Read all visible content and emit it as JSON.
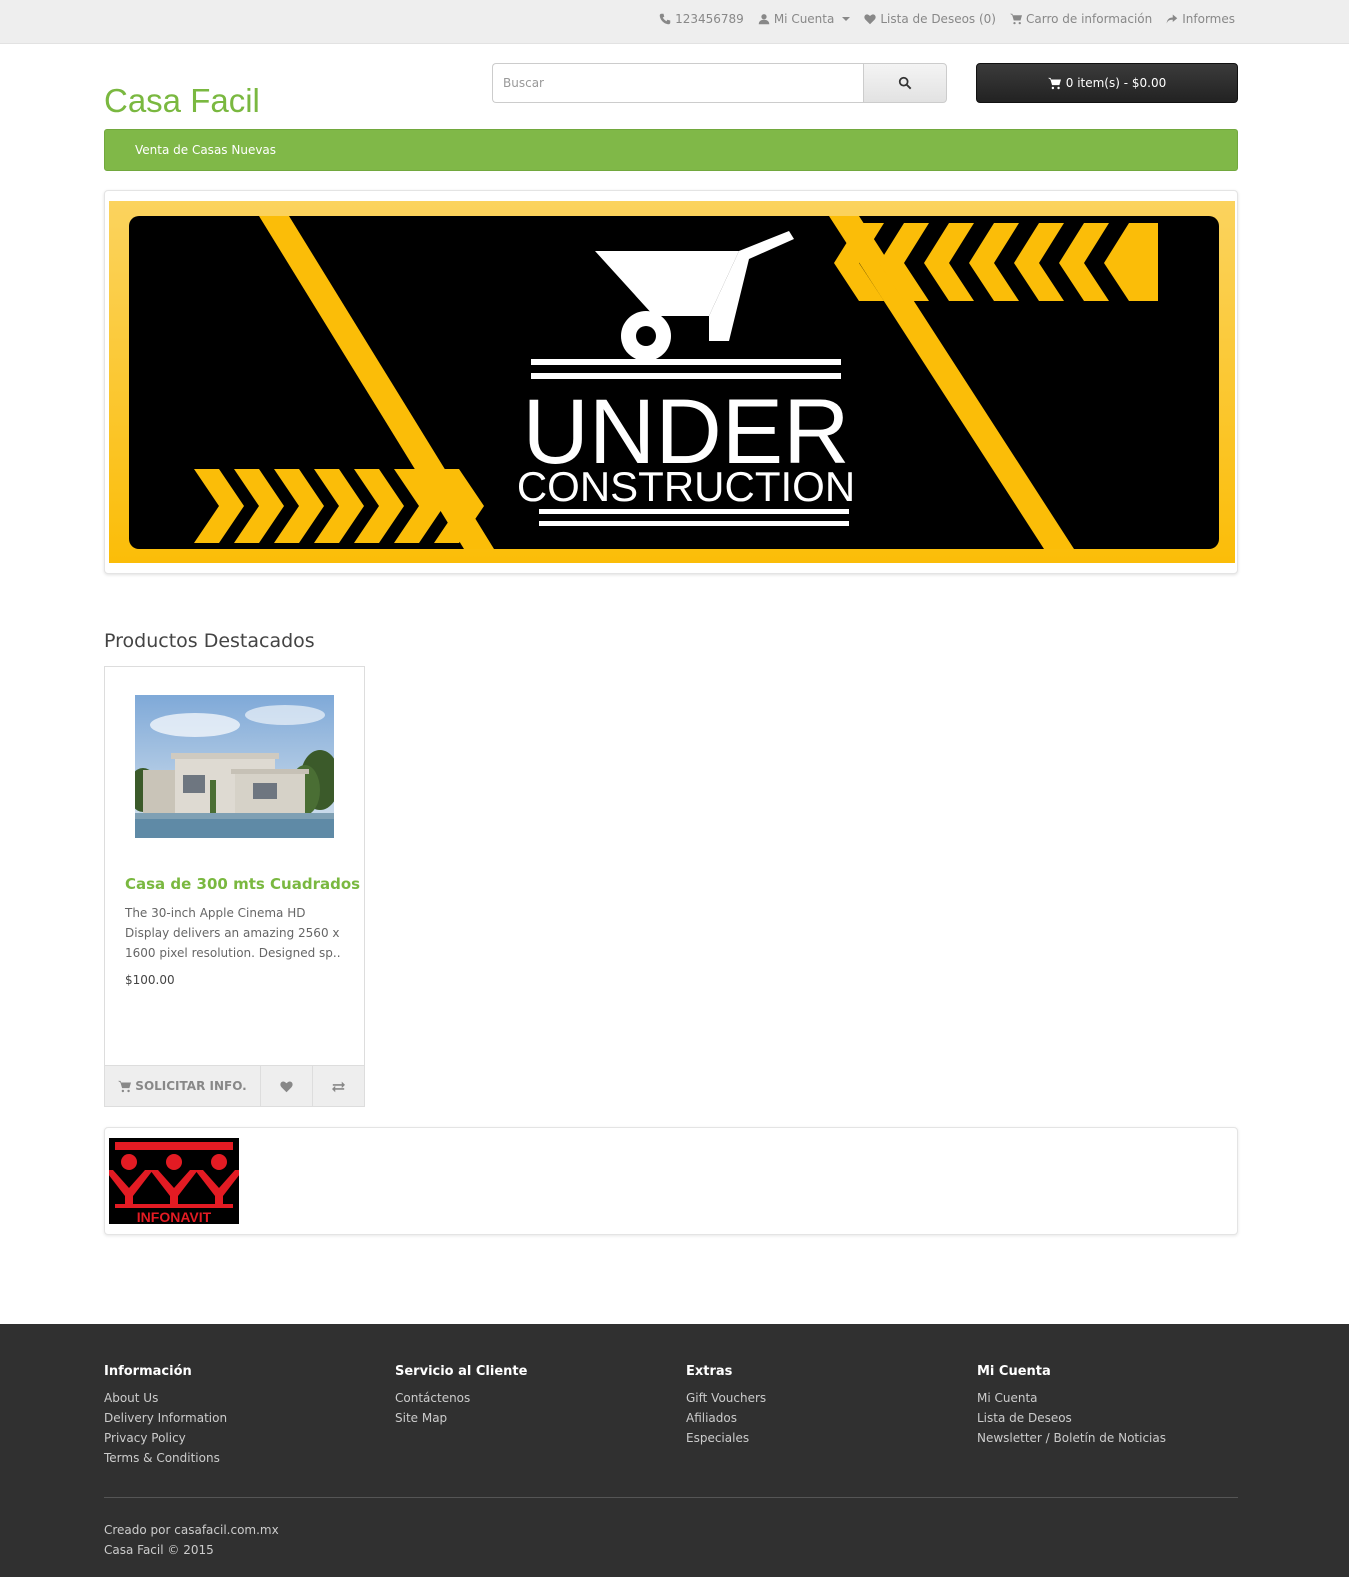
{
  "topbar": {
    "phone": "123456789",
    "account": "Mi Cuenta",
    "wishlist": "Lista de Deseos (0)",
    "cart": "Carro de información",
    "checkout": "Informes"
  },
  "header": {
    "logo": "Casa Facil",
    "search_placeholder": "Buscar",
    "cart_button": "0 item(s) - $0.00"
  },
  "nav": {
    "items": [
      "Venta de Casas Nuevas"
    ]
  },
  "banner": {
    "line1": "UNDER",
    "line2": "CONSTRUCTION"
  },
  "featured": {
    "title": "Productos Destacados",
    "products": [
      {
        "name": "Casa de 300 mts Cuadrados",
        "description": "The 30-inch Apple Cinema HD Display delivers an amazing 2560 x 1600 pixel resolution. Designed sp..",
        "price": "$100.00",
        "cart_label": "SOLICITAR INFO."
      }
    ]
  },
  "carousel": {
    "logo_text": "INFONAVIT"
  },
  "footer": {
    "columns": [
      {
        "title": "Información",
        "links": [
          "About Us",
          "Delivery Information",
          "Privacy Policy",
          "Terms & Conditions"
        ]
      },
      {
        "title": "Servicio al Cliente",
        "links": [
          "Contáctenos",
          "Site Map"
        ]
      },
      {
        "title": "Extras",
        "links": [
          "Gift Vouchers",
          "Afiliados",
          "Especiales"
        ]
      },
      {
        "title": "Mi Cuenta",
        "links": [
          "Mi Cuenta",
          "Lista de Deseos",
          "Newsletter / Boletín de Noticias"
        ]
      }
    ],
    "credit_prefix": "Creado por ",
    "credit_link": "casafacil.com.mx",
    "copyright": "Casa Facil © 2015"
  },
  "colors": {
    "brand_green": "#7ab840",
    "nav_green": "#80b848",
    "banner_yellow": "#fbbd08",
    "footer_bg": "#303030"
  }
}
